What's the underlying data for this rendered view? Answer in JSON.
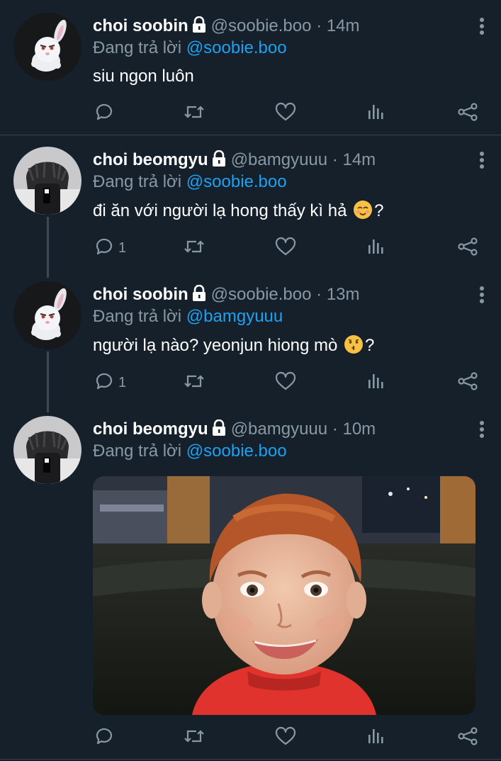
{
  "reply_prefix": "Đang trả lời",
  "icons": {
    "lock": "lock-icon",
    "more": "more-vertical-icon",
    "reply": "reply-icon",
    "retweet": "retweet-icon",
    "like": "heart-icon",
    "stats": "stats-icon",
    "share": "share-icon"
  },
  "colors": {
    "background": "#15202b",
    "mention": "#1da1f2",
    "secondary_text": "#8899a6",
    "divider": "#38444d"
  },
  "tweets": [
    {
      "name": "choi soobin",
      "handle": "@soobie.boo",
      "sep": "·",
      "time": "14m",
      "reply_to": "@soobie.boo",
      "text": "siu ngon luôn",
      "replies": ""
    },
    {
      "name": "choi beomgyu",
      "handle": "@bamgyuuu",
      "sep": "·",
      "time": "14m",
      "reply_to": "@soobie.boo",
      "text": "đi ăn với người lạ hong thấy kì hả",
      "text_suffix": "?",
      "emoji": "smiling-face-icon",
      "replies": "1"
    },
    {
      "name": "choi soobin",
      "handle": "@soobie.boo",
      "sep": "·",
      "time": "13m",
      "reply_to": "@bamgyuuu",
      "text": "người lạ nào? yeonjun hiong mò",
      "text_suffix": "?",
      "emoji": "kissing-face-icon",
      "replies": "1"
    },
    {
      "name": "choi beomgyu",
      "handle": "@bamgyuuu",
      "sep": "·",
      "time": "10m",
      "reply_to": "@soobie.boo",
      "media": "photo-of-smiling-boy",
      "replies": ""
    }
  ]
}
